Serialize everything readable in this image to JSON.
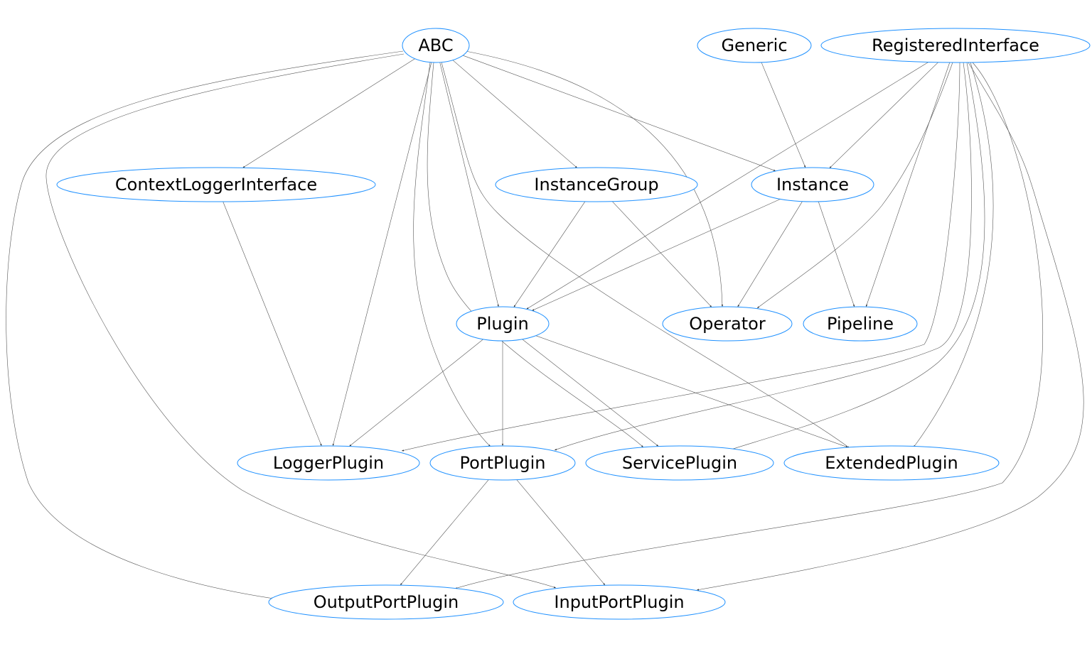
{
  "colors": {
    "node_border": "#1e90ff",
    "edge": "#555555",
    "background": "#ffffff"
  },
  "nodes": [
    {
      "id": "ABC",
      "label": "ABC"
    },
    {
      "id": "Generic",
      "label": "Generic"
    },
    {
      "id": "RegisteredInterface",
      "label": "RegisteredInterface"
    },
    {
      "id": "ContextLoggerInterface",
      "label": "ContextLoggerInterface"
    },
    {
      "id": "InstanceGroup",
      "label": "InstanceGroup"
    },
    {
      "id": "Instance",
      "label": "Instance"
    },
    {
      "id": "Plugin",
      "label": "Plugin"
    },
    {
      "id": "Operator",
      "label": "Operator"
    },
    {
      "id": "Pipeline",
      "label": "Pipeline"
    },
    {
      "id": "LoggerPlugin",
      "label": "LoggerPlugin"
    },
    {
      "id": "PortPlugin",
      "label": "PortPlugin"
    },
    {
      "id": "ServicePlugin",
      "label": "ServicePlugin"
    },
    {
      "id": "ExtendedPlugin",
      "label": "ExtendedPlugin"
    },
    {
      "id": "OutputPortPlugin",
      "label": "OutputPortPlugin"
    },
    {
      "id": "InputPortPlugin",
      "label": "InputPortPlugin"
    }
  ],
  "edges": [
    [
      "ABC",
      "ContextLoggerInterface"
    ],
    [
      "ABC",
      "InstanceGroup"
    ],
    [
      "ABC",
      "Instance"
    ],
    [
      "ABC",
      "Operator"
    ],
    [
      "ABC",
      "Plugin"
    ],
    [
      "ABC",
      "LoggerPlugin"
    ],
    [
      "ABC",
      "PortPlugin"
    ],
    [
      "ABC",
      "ServicePlugin"
    ],
    [
      "ABC",
      "ExtendedPlugin"
    ],
    [
      "ABC",
      "OutputPortPlugin"
    ],
    [
      "ABC",
      "InputPortPlugin"
    ],
    [
      "Generic",
      "Instance"
    ],
    [
      "RegisteredInterface",
      "Plugin"
    ],
    [
      "RegisteredInterface",
      "Instance"
    ],
    [
      "RegisteredInterface",
      "Operator"
    ],
    [
      "RegisteredInterface",
      "Pipeline"
    ],
    [
      "RegisteredInterface",
      "LoggerPlugin"
    ],
    [
      "RegisteredInterface",
      "PortPlugin"
    ],
    [
      "RegisteredInterface",
      "ServicePlugin"
    ],
    [
      "RegisteredInterface",
      "ExtendedPlugin"
    ],
    [
      "RegisteredInterface",
      "OutputPortPlugin"
    ],
    [
      "RegisteredInterface",
      "InputPortPlugin"
    ],
    [
      "ContextLoggerInterface",
      "LoggerPlugin"
    ],
    [
      "InstanceGroup",
      "Plugin"
    ],
    [
      "InstanceGroup",
      "Operator"
    ],
    [
      "Instance",
      "Plugin"
    ],
    [
      "Instance",
      "Operator"
    ],
    [
      "Instance",
      "Pipeline"
    ],
    [
      "Plugin",
      "LoggerPlugin"
    ],
    [
      "Plugin",
      "PortPlugin"
    ],
    [
      "Plugin",
      "ServicePlugin"
    ],
    [
      "Plugin",
      "ExtendedPlugin"
    ],
    [
      "PortPlugin",
      "OutputPortPlugin"
    ],
    [
      "PortPlugin",
      "InputPortPlugin"
    ]
  ]
}
